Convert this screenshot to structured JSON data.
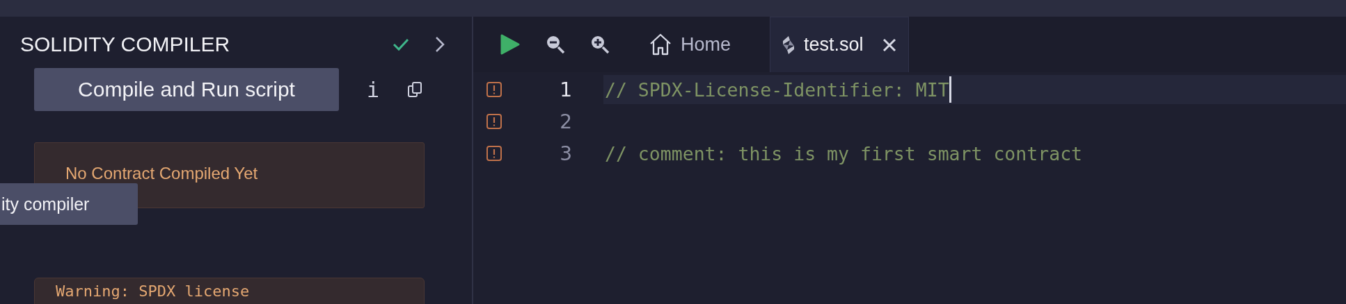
{
  "panel": {
    "title": "SOLIDITY COMPILER",
    "compile_button": "Compile and Run script",
    "info_icon": "i",
    "status": "No Contract Compiled Yet",
    "tooltip": "ity compiler",
    "warning": "Warning: SPDX license"
  },
  "editor": {
    "tabs": [
      {
        "label": "Home",
        "selected": false,
        "closable": false
      },
      {
        "label": "test.sol",
        "selected": true,
        "closable": true
      }
    ],
    "lines": [
      {
        "number": "1",
        "text": "// SPDX-License-Identifier: MIT",
        "current": true
      },
      {
        "number": "2",
        "current": false
      },
      {
        "number": "3",
        "text": "// comment: this is my first smart contract",
        "current": false
      }
    ]
  }
}
